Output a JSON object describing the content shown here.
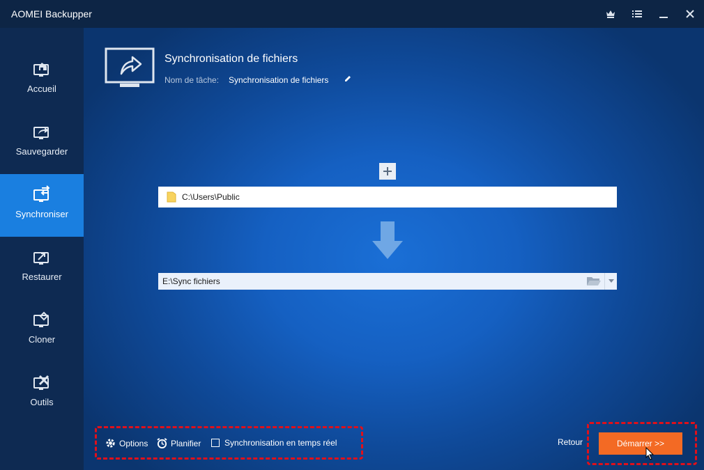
{
  "window": {
    "title": "AOMEI Backupper"
  },
  "sidebar": {
    "items": [
      {
        "label": "Accueil",
        "icon": "home-monitor-icon"
      },
      {
        "label": "Sauvegarder",
        "icon": "backup-monitor-icon"
      },
      {
        "label": "Synchroniser",
        "icon": "sync-monitor-icon",
        "active": true
      },
      {
        "label": "Restaurer",
        "icon": "restore-monitor-icon"
      },
      {
        "label": "Cloner",
        "icon": "clone-monitor-icon"
      },
      {
        "label": "Outils",
        "icon": "tools-monitor-icon"
      }
    ]
  },
  "header": {
    "title": "Synchronisation de fichiers",
    "task_name_label": "Nom de tâche:",
    "task_name_value": "Synchronisation de fichiers"
  },
  "source": {
    "path": "C:\\Users\\Public"
  },
  "destination": {
    "path": "E:\\Sync fichiers"
  },
  "footer": {
    "options_label": "Options",
    "schedule_label": "Planifier",
    "realtime_label": "Synchronisation en temps réel",
    "realtime_checked": false,
    "back_label": "Retour",
    "start_label": "Démarrer >>"
  },
  "colors": {
    "accent": "#1a7fe0",
    "start_button": "#f36a24",
    "highlight_border": "#e0101a"
  }
}
